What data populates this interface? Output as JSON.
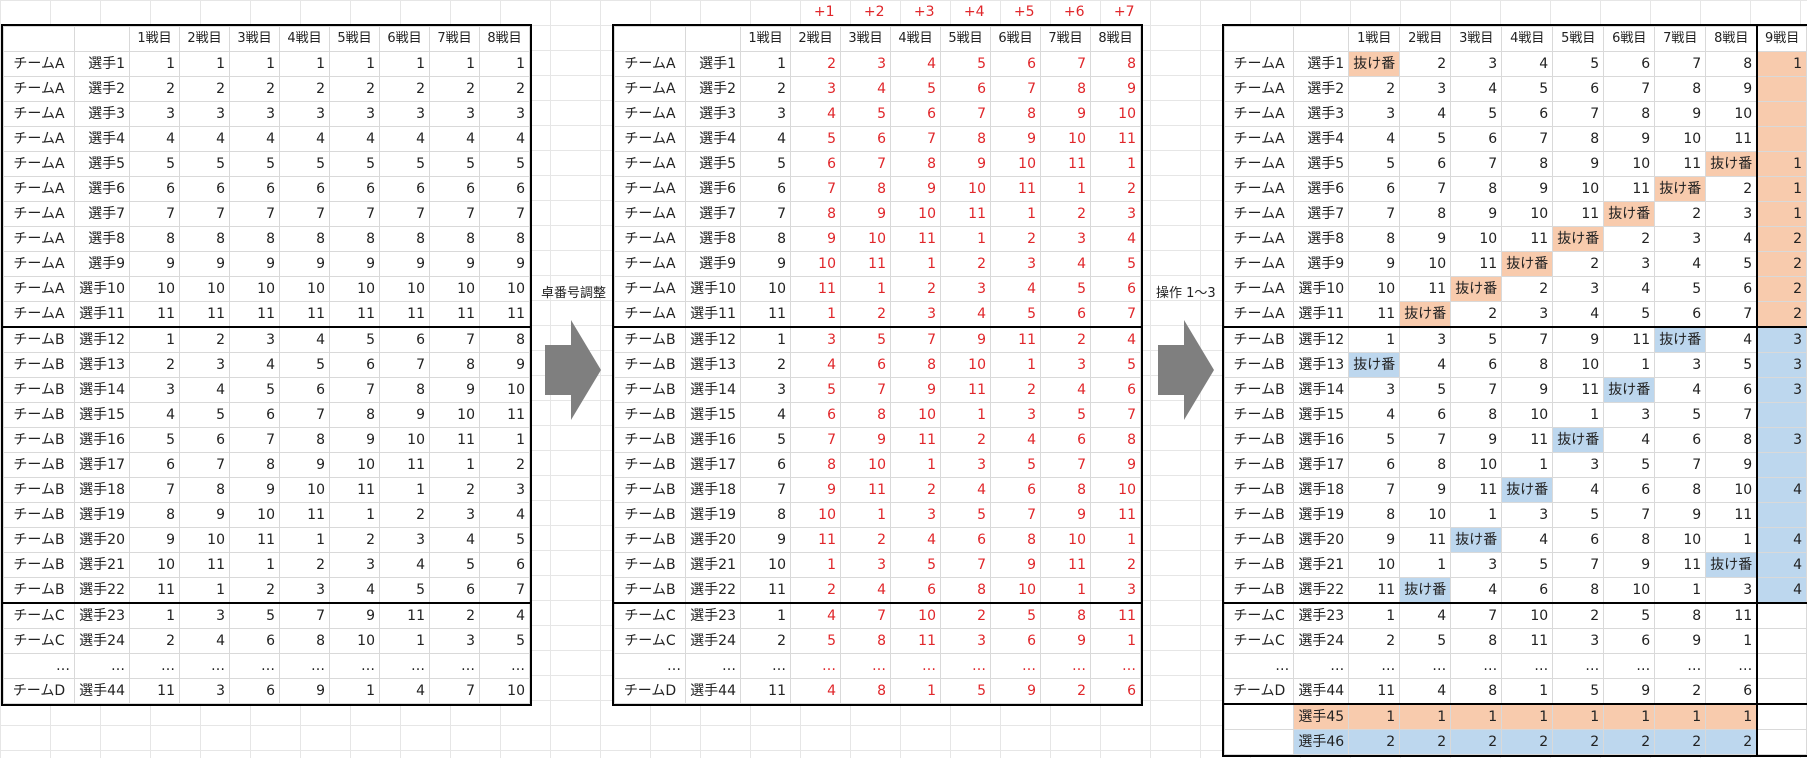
{
  "labels": {
    "adjust": "卓番号調整",
    "ops": "操作 1〜3"
  },
  "offsets": [
    "+1",
    "+2",
    "+3",
    "+4",
    "+5",
    "+6",
    "+7"
  ],
  "headers8": [
    "1戦目",
    "2戦目",
    "3戦目",
    "4戦目",
    "5戦目",
    "6戦目",
    "7戦目",
    "8戦目"
  ],
  "headers9": [
    "1戦目",
    "2戦目",
    "3戦目",
    "4戦目",
    "5戦目",
    "6戦目",
    "7戦目",
    "8戦目",
    "9戦目"
  ],
  "bye": "抜け番",
  "colors": {
    "red": "#e0262a",
    "orange": "#f8cbad",
    "blue": "#bdd7ee"
  },
  "table1": [
    {
      "team": "チームA",
      "player": "選手1",
      "v": [
        "1",
        "1",
        "1",
        "1",
        "1",
        "1",
        "1",
        "1"
      ]
    },
    {
      "team": "チームA",
      "player": "選手2",
      "v": [
        "2",
        "2",
        "2",
        "2",
        "2",
        "2",
        "2",
        "2"
      ]
    },
    {
      "team": "チームA",
      "player": "選手3",
      "v": [
        "3",
        "3",
        "3",
        "3",
        "3",
        "3",
        "3",
        "3"
      ]
    },
    {
      "team": "チームA",
      "player": "選手4",
      "v": [
        "4",
        "4",
        "4",
        "4",
        "4",
        "4",
        "4",
        "4"
      ]
    },
    {
      "team": "チームA",
      "player": "選手5",
      "v": [
        "5",
        "5",
        "5",
        "5",
        "5",
        "5",
        "5",
        "5"
      ]
    },
    {
      "team": "チームA",
      "player": "選手6",
      "v": [
        "6",
        "6",
        "6",
        "6",
        "6",
        "6",
        "6",
        "6"
      ]
    },
    {
      "team": "チームA",
      "player": "選手7",
      "v": [
        "7",
        "7",
        "7",
        "7",
        "7",
        "7",
        "7",
        "7"
      ]
    },
    {
      "team": "チームA",
      "player": "選手8",
      "v": [
        "8",
        "8",
        "8",
        "8",
        "8",
        "8",
        "8",
        "8"
      ]
    },
    {
      "team": "チームA",
      "player": "選手9",
      "v": [
        "9",
        "9",
        "9",
        "9",
        "9",
        "9",
        "9",
        "9"
      ]
    },
    {
      "team": "チームA",
      "player": "選手10",
      "v": [
        "10",
        "10",
        "10",
        "10",
        "10",
        "10",
        "10",
        "10"
      ]
    },
    {
      "team": "チームA",
      "player": "選手11",
      "v": [
        "11",
        "11",
        "11",
        "11",
        "11",
        "11",
        "11",
        "11"
      ]
    },
    {
      "team": "チームB",
      "player": "選手12",
      "v": [
        "1",
        "2",
        "3",
        "4",
        "5",
        "6",
        "7",
        "8"
      ]
    },
    {
      "team": "チームB",
      "player": "選手13",
      "v": [
        "2",
        "3",
        "4",
        "5",
        "6",
        "7",
        "8",
        "9"
      ]
    },
    {
      "team": "チームB",
      "player": "選手14",
      "v": [
        "3",
        "4",
        "5",
        "6",
        "7",
        "8",
        "9",
        "10"
      ]
    },
    {
      "team": "チームB",
      "player": "選手15",
      "v": [
        "4",
        "5",
        "6",
        "7",
        "8",
        "9",
        "10",
        "11"
      ]
    },
    {
      "team": "チームB",
      "player": "選手16",
      "v": [
        "5",
        "6",
        "7",
        "8",
        "9",
        "10",
        "11",
        "1"
      ]
    },
    {
      "team": "チームB",
      "player": "選手17",
      "v": [
        "6",
        "7",
        "8",
        "9",
        "10",
        "11",
        "1",
        "2"
      ]
    },
    {
      "team": "チームB",
      "player": "選手18",
      "v": [
        "7",
        "8",
        "9",
        "10",
        "11",
        "1",
        "2",
        "3"
      ]
    },
    {
      "team": "チームB",
      "player": "選手19",
      "v": [
        "8",
        "9",
        "10",
        "11",
        "1",
        "2",
        "3",
        "4"
      ]
    },
    {
      "team": "チームB",
      "player": "選手20",
      "v": [
        "9",
        "10",
        "11",
        "1",
        "2",
        "3",
        "4",
        "5"
      ]
    },
    {
      "team": "チームB",
      "player": "選手21",
      "v": [
        "10",
        "11",
        "1",
        "2",
        "3",
        "4",
        "5",
        "6"
      ]
    },
    {
      "team": "チームB",
      "player": "選手22",
      "v": [
        "11",
        "1",
        "2",
        "3",
        "4",
        "5",
        "6",
        "7"
      ]
    },
    {
      "team": "チームC",
      "player": "選手23",
      "v": [
        "1",
        "3",
        "5",
        "7",
        "9",
        "11",
        "2",
        "4"
      ]
    },
    {
      "team": "チームC",
      "player": "選手24",
      "v": [
        "2",
        "4",
        "6",
        "8",
        "10",
        "1",
        "3",
        "5"
      ]
    },
    {
      "team": "…",
      "player": "…",
      "v": [
        "…",
        "…",
        "…",
        "…",
        "…",
        "…",
        "…",
        "…"
      ]
    },
    {
      "team": "チームD",
      "player": "選手44",
      "v": [
        "11",
        "3",
        "6",
        "9",
        "1",
        "4",
        "7",
        "10"
      ]
    }
  ],
  "table2": [
    {
      "team": "チームA",
      "player": "選手1",
      "v": [
        "1",
        "2",
        "3",
        "4",
        "5",
        "6",
        "7",
        "8"
      ]
    },
    {
      "team": "チームA",
      "player": "選手2",
      "v": [
        "2",
        "3",
        "4",
        "5",
        "6",
        "7",
        "8",
        "9"
      ]
    },
    {
      "team": "チームA",
      "player": "選手3",
      "v": [
        "3",
        "4",
        "5",
        "6",
        "7",
        "8",
        "9",
        "10"
      ]
    },
    {
      "team": "チームA",
      "player": "選手4",
      "v": [
        "4",
        "5",
        "6",
        "7",
        "8",
        "9",
        "10",
        "11"
      ]
    },
    {
      "team": "チームA",
      "player": "選手5",
      "v": [
        "5",
        "6",
        "7",
        "8",
        "9",
        "10",
        "11",
        "1"
      ]
    },
    {
      "team": "チームA",
      "player": "選手6",
      "v": [
        "6",
        "7",
        "8",
        "9",
        "10",
        "11",
        "1",
        "2"
      ]
    },
    {
      "team": "チームA",
      "player": "選手7",
      "v": [
        "7",
        "8",
        "9",
        "10",
        "11",
        "1",
        "2",
        "3"
      ]
    },
    {
      "team": "チームA",
      "player": "選手8",
      "v": [
        "8",
        "9",
        "10",
        "11",
        "1",
        "2",
        "3",
        "4"
      ]
    },
    {
      "team": "チームA",
      "player": "選手9",
      "v": [
        "9",
        "10",
        "11",
        "1",
        "2",
        "3",
        "4",
        "5"
      ]
    },
    {
      "team": "チームA",
      "player": "選手10",
      "v": [
        "10",
        "11",
        "1",
        "2",
        "3",
        "4",
        "5",
        "6"
      ]
    },
    {
      "team": "チームA",
      "player": "選手11",
      "v": [
        "11",
        "1",
        "2",
        "3",
        "4",
        "5",
        "6",
        "7"
      ]
    },
    {
      "team": "チームB",
      "player": "選手12",
      "v": [
        "1",
        "3",
        "5",
        "7",
        "9",
        "11",
        "2",
        "4"
      ]
    },
    {
      "team": "チームB",
      "player": "選手13",
      "v": [
        "2",
        "4",
        "6",
        "8",
        "10",
        "1",
        "3",
        "5"
      ]
    },
    {
      "team": "チームB",
      "player": "選手14",
      "v": [
        "3",
        "5",
        "7",
        "9",
        "11",
        "2",
        "4",
        "6"
      ]
    },
    {
      "team": "チームB",
      "player": "選手15",
      "v": [
        "4",
        "6",
        "8",
        "10",
        "1",
        "3",
        "5",
        "7"
      ]
    },
    {
      "team": "チームB",
      "player": "選手16",
      "v": [
        "5",
        "7",
        "9",
        "11",
        "2",
        "4",
        "6",
        "8"
      ]
    },
    {
      "team": "チームB",
      "player": "選手17",
      "v": [
        "6",
        "8",
        "10",
        "1",
        "3",
        "5",
        "7",
        "9"
      ]
    },
    {
      "team": "チームB",
      "player": "選手18",
      "v": [
        "7",
        "9",
        "11",
        "2",
        "4",
        "6",
        "8",
        "10"
      ]
    },
    {
      "team": "チームB",
      "player": "選手19",
      "v": [
        "8",
        "10",
        "1",
        "3",
        "5",
        "7",
        "9",
        "11"
      ]
    },
    {
      "team": "チームB",
      "player": "選手20",
      "v": [
        "9",
        "11",
        "2",
        "4",
        "6",
        "8",
        "10",
        "1"
      ]
    },
    {
      "team": "チームB",
      "player": "選手21",
      "v": [
        "10",
        "1",
        "3",
        "5",
        "7",
        "9",
        "11",
        "2"
      ]
    },
    {
      "team": "チームB",
      "player": "選手22",
      "v": [
        "11",
        "2",
        "4",
        "6",
        "8",
        "10",
        "1",
        "3"
      ]
    },
    {
      "team": "チームC",
      "player": "選手23",
      "v": [
        "1",
        "4",
        "7",
        "10",
        "2",
        "5",
        "8",
        "11"
      ]
    },
    {
      "team": "チームC",
      "player": "選手24",
      "v": [
        "2",
        "5",
        "8",
        "11",
        "3",
        "6",
        "9",
        "1"
      ]
    },
    {
      "team": "…",
      "player": "…",
      "v": [
        "…",
        "…",
        "…",
        "…",
        "…",
        "…",
        "…",
        "…"
      ]
    },
    {
      "team": "チームD",
      "player": "選手44",
      "v": [
        "11",
        "4",
        "8",
        "1",
        "5",
        "9",
        "2",
        "6"
      ]
    }
  ],
  "table3": [
    {
      "team": "チームA",
      "player": "選手1",
      "v": [
        "抜け番",
        "2",
        "3",
        "4",
        "5",
        "6",
        "7",
        "8",
        "1"
      ],
      "hl": [
        0,
        8
      ],
      "c": "orange"
    },
    {
      "team": "チームA",
      "player": "選手2",
      "v": [
        "2",
        "3",
        "4",
        "5",
        "6",
        "7",
        "8",
        "9",
        ""
      ],
      "hl": [],
      "c": "orange"
    },
    {
      "team": "チームA",
      "player": "選手3",
      "v": [
        "3",
        "4",
        "5",
        "6",
        "7",
        "8",
        "9",
        "10",
        ""
      ],
      "hl": [],
      "c": "orange"
    },
    {
      "team": "チームA",
      "player": "選手4",
      "v": [
        "4",
        "5",
        "6",
        "7",
        "8",
        "9",
        "10",
        "11",
        ""
      ],
      "hl": [],
      "c": "orange"
    },
    {
      "team": "チームA",
      "player": "選手5",
      "v": [
        "5",
        "6",
        "7",
        "8",
        "9",
        "10",
        "11",
        "抜け番",
        "1"
      ],
      "hl": [
        7,
        8
      ],
      "c": "orange"
    },
    {
      "team": "チームA",
      "player": "選手6",
      "v": [
        "6",
        "7",
        "8",
        "9",
        "10",
        "11",
        "抜け番",
        "2",
        "1"
      ],
      "hl": [
        6,
        8
      ],
      "c": "orange"
    },
    {
      "team": "チームA",
      "player": "選手7",
      "v": [
        "7",
        "8",
        "9",
        "10",
        "11",
        "抜け番",
        "2",
        "3",
        "1"
      ],
      "hl": [
        5,
        8
      ],
      "c": "orange"
    },
    {
      "team": "チームA",
      "player": "選手8",
      "v": [
        "8",
        "9",
        "10",
        "11",
        "抜け番",
        "2",
        "3",
        "4",
        "2"
      ],
      "hl": [
        4,
        8
      ],
      "c": "orange"
    },
    {
      "team": "チームA",
      "player": "選手9",
      "v": [
        "9",
        "10",
        "11",
        "抜け番",
        "2",
        "3",
        "4",
        "5",
        "2"
      ],
      "hl": [
        3,
        8
      ],
      "c": "orange"
    },
    {
      "team": "チームA",
      "player": "選手10",
      "v": [
        "10",
        "11",
        "抜け番",
        "2",
        "3",
        "4",
        "5",
        "6",
        "2"
      ],
      "hl": [
        2,
        8
      ],
      "c": "orange"
    },
    {
      "team": "チームA",
      "player": "選手11",
      "v": [
        "11",
        "抜け番",
        "2",
        "3",
        "4",
        "5",
        "6",
        "7",
        "2"
      ],
      "hl": [
        1,
        8
      ],
      "c": "orange"
    },
    {
      "team": "チームB",
      "player": "選手12",
      "v": [
        "1",
        "3",
        "5",
        "7",
        "9",
        "11",
        "抜け番",
        "4",
        "3"
      ],
      "hl": [
        6,
        8
      ],
      "c": "blue"
    },
    {
      "team": "チームB",
      "player": "選手13",
      "v": [
        "抜け番",
        "4",
        "6",
        "8",
        "10",
        "1",
        "3",
        "5",
        "3"
      ],
      "hl": [
        0,
        8
      ],
      "c": "blue"
    },
    {
      "team": "チームB",
      "player": "選手14",
      "v": [
        "3",
        "5",
        "7",
        "9",
        "11",
        "抜け番",
        "4",
        "6",
        "3"
      ],
      "hl": [
        5,
        8
      ],
      "c": "blue"
    },
    {
      "team": "チームB",
      "player": "選手15",
      "v": [
        "4",
        "6",
        "8",
        "10",
        "1",
        "3",
        "5",
        "7",
        ""
      ],
      "hl": [],
      "c": "blue"
    },
    {
      "team": "チームB",
      "player": "選手16",
      "v": [
        "5",
        "7",
        "9",
        "11",
        "抜け番",
        "4",
        "6",
        "8",
        "3"
      ],
      "hl": [
        4,
        8
      ],
      "c": "blue"
    },
    {
      "team": "チームB",
      "player": "選手17",
      "v": [
        "6",
        "8",
        "10",
        "1",
        "3",
        "5",
        "7",
        "9",
        ""
      ],
      "hl": [],
      "c": "blue"
    },
    {
      "team": "チームB",
      "player": "選手18",
      "v": [
        "7",
        "9",
        "11",
        "抜け番",
        "4",
        "6",
        "8",
        "10",
        "4"
      ],
      "hl": [
        3,
        8
      ],
      "c": "blue"
    },
    {
      "team": "チームB",
      "player": "選手19",
      "v": [
        "8",
        "10",
        "1",
        "3",
        "5",
        "7",
        "9",
        "11",
        ""
      ],
      "hl": [],
      "c": "blue"
    },
    {
      "team": "チームB",
      "player": "選手20",
      "v": [
        "9",
        "11",
        "抜け番",
        "4",
        "6",
        "8",
        "10",
        "1",
        "4"
      ],
      "hl": [
        2,
        8
      ],
      "c": "blue"
    },
    {
      "team": "チームB",
      "player": "選手21",
      "v": [
        "10",
        "1",
        "3",
        "5",
        "7",
        "9",
        "11",
        "抜け番",
        "4"
      ],
      "hl": [
        7,
        8
      ],
      "c": "blue"
    },
    {
      "team": "チームB",
      "player": "選手22",
      "v": [
        "11",
        "抜け番",
        "4",
        "6",
        "8",
        "10",
        "1",
        "3",
        "4"
      ],
      "hl": [
        1,
        8
      ],
      "c": "blue"
    },
    {
      "team": "チームC",
      "player": "選手23",
      "v": [
        "1",
        "4",
        "7",
        "10",
        "2",
        "5",
        "8",
        "11",
        ""
      ],
      "hl": [],
      "c": ""
    },
    {
      "team": "チームC",
      "player": "選手24",
      "v": [
        "2",
        "5",
        "8",
        "11",
        "3",
        "6",
        "9",
        "1",
        ""
      ],
      "hl": [],
      "c": ""
    },
    {
      "team": "…",
      "player": "…",
      "v": [
        "…",
        "…",
        "…",
        "…",
        "…",
        "…",
        "…",
        "…",
        ""
      ],
      "hl": [],
      "c": ""
    },
    {
      "team": "チームD",
      "player": "選手44",
      "v": [
        "11",
        "4",
        "8",
        "1",
        "5",
        "9",
        "2",
        "6",
        ""
      ],
      "hl": [],
      "c": ""
    }
  ],
  "extra": [
    {
      "player": "選手45",
      "v": [
        "1",
        "1",
        "1",
        "1",
        "1",
        "1",
        "1",
        "1"
      ],
      "c": "orange"
    },
    {
      "player": "選手46",
      "v": [
        "2",
        "2",
        "2",
        "2",
        "2",
        "2",
        "2",
        "2"
      ],
      "c": "blue"
    }
  ]
}
